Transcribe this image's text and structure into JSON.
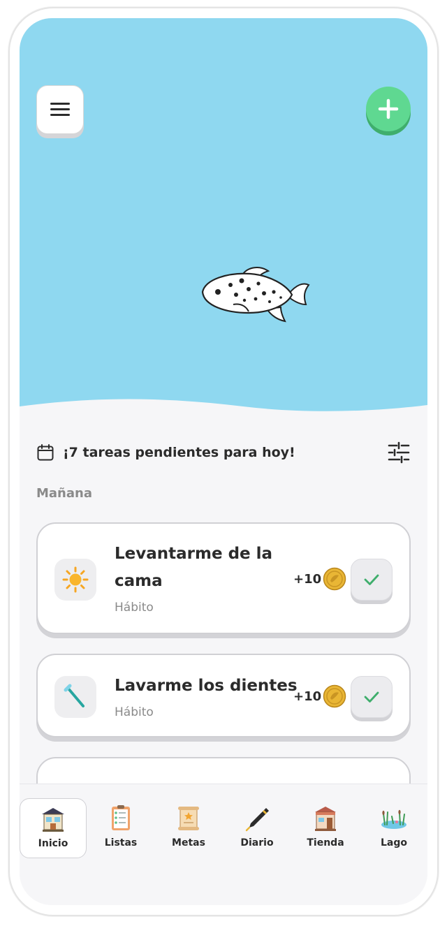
{
  "header": {
    "menu_icon": "hamburger-menu-icon",
    "add_icon": "plus-icon"
  },
  "summary": {
    "calendar_icon": "calendar-icon",
    "text": "¡7 tareas pendientes para hoy!",
    "filter_icon": "sliders-icon"
  },
  "section": {
    "label": "Mañana"
  },
  "tasks": [
    {
      "title_line1": "Levantarme de la",
      "title_line2": "cama",
      "type": "Hábito",
      "reward": "+10",
      "icon": "sun-icon"
    },
    {
      "title_line1": "Lavarme los dientes",
      "title_line2": "",
      "type": "Hábito",
      "reward": "+10",
      "icon": "toothbrush-icon"
    }
  ],
  "nav": {
    "items": [
      {
        "label": "Inicio",
        "icon": "house-icon",
        "active": true
      },
      {
        "label": "Listas",
        "icon": "checklist-icon",
        "active": false
      },
      {
        "label": "Metas",
        "icon": "scroll-icon",
        "active": false
      },
      {
        "label": "Diario",
        "icon": "pen-icon",
        "active": false
      },
      {
        "label": "Tienda",
        "icon": "shop-icon",
        "active": false
      },
      {
        "label": "Lago",
        "icon": "lake-icon",
        "active": false
      }
    ]
  },
  "colors": {
    "sky": "#8fd8f0",
    "add_button": "#5fd891",
    "check": "#3fae6c",
    "coin": "#e9b635"
  }
}
